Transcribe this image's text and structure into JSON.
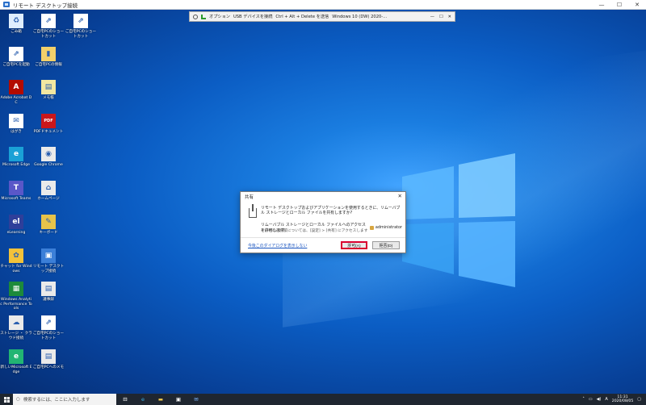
{
  "window": {
    "title": "リモート デスクトップ接続",
    "minimize": "—",
    "maximize": "☐",
    "close": "✕"
  },
  "rdp_bar": {
    "options": "オプション",
    "usb": "USB デバイスを接続",
    "cad": "Ctrl + Alt + Delete を送信",
    "host": "Windows 10 (DW) 2020-..."
  },
  "desktop_icons": [
    {
      "id": "recycle",
      "label": "ごみ箱",
      "glyph": "♻",
      "color": "#dfeeff"
    },
    {
      "id": "shortcut-a",
      "label": "ご自宅PCのショートカット",
      "glyph": "⇗",
      "color": "#ffffff"
    },
    {
      "id": "shortcut-b",
      "label": "ご自宅PCのショートカット",
      "glyph": "⇗",
      "color": "#ffffff"
    },
    {
      "id": "remote",
      "label": "ご自宅PCを起動",
      "glyph": "⇗",
      "color": "#ffffff"
    },
    {
      "id": "folder",
      "label": "ご自宅PCの情報",
      "glyph": "▮",
      "color": "#f2d06b"
    },
    {
      "id": "acrobat",
      "label": "Adobe Acrobat DC",
      "glyph": "A",
      "color": "#b30b00"
    },
    {
      "id": "memo",
      "label": "メモ帳",
      "glyph": "▤",
      "color": "#f2e7a1"
    },
    {
      "id": "mail",
      "label": "はがき",
      "glyph": "✉",
      "color": "#ffffff"
    },
    {
      "id": "pdf",
      "label": "PDFドキュメント",
      "glyph": "PDF",
      "color": "#c9161b"
    },
    {
      "id": "edge",
      "label": "Microsoft Edge",
      "glyph": "e",
      "color": "#1aa1d6"
    },
    {
      "id": "chrome",
      "label": "Google Chrome",
      "glyph": "◉",
      "color": "#eaeaea"
    },
    {
      "id": "teams",
      "label": "Microsoft Teams",
      "glyph": "T",
      "color": "#5a57c8"
    },
    {
      "id": "home",
      "label": "ホームページ",
      "glyph": "⌂",
      "color": "#eaeaea"
    },
    {
      "id": "el",
      "label": "eLearning",
      "glyph": "el",
      "color": "#2f3f9a"
    },
    {
      "id": "keys",
      "label": "キーボード",
      "glyph": "✎",
      "color": "#e6c34a"
    },
    {
      "id": "chat",
      "label": "チャット for Windows",
      "glyph": "✿",
      "color": "#f2c23a"
    },
    {
      "id": "pc",
      "label": "リモート デスクトップ接続",
      "glyph": "▣",
      "color": "#3b7fd8"
    },
    {
      "id": "perf",
      "label": "Windows Analytic Performance Tools",
      "glyph": "▦",
      "color": "#1d8a3b"
    },
    {
      "id": "note",
      "label": "議事録",
      "glyph": "▤",
      "color": "#eaeaea"
    },
    {
      "id": "cloud",
      "label": "ストレージ ・ クラウド接続",
      "glyph": "☁",
      "color": "#eaeaea"
    },
    {
      "id": "shortcut-c",
      "label": "ご自宅PCのショートカット",
      "glyph": "⇗",
      "color": "#ffffff"
    },
    {
      "id": "edge2",
      "label": "新しいMicrosoft Edge",
      "glyph": "e",
      "color": "#22b573"
    },
    {
      "id": "doc",
      "label": "ご自宅PCへのメモ",
      "glyph": "▤",
      "color": "#eaeaea"
    }
  ],
  "dialog": {
    "title": "共有",
    "close": "✕",
    "main_text": "リモート デスクトップおよびアプリケーションを使用するときに、リムーバブル ストレージとローカル ファイルを共有しますか?",
    "sub_text": "リムーバブル ストレージとローカル ファイルへのアクセスを許可します:",
    "user": "administrator",
    "note": "その他の選択肢については、[設定] > [共有] にアクセスします",
    "dont_show": "今後このダイアログを表示しない",
    "allow": "許可(A)",
    "deny": "拒否(D)",
    "allow_highlight": "#d9002f"
  },
  "taskbar": {
    "search_placeholder": "検索するには、ここに入力します",
    "time": "11:31",
    "date": "2020/08/05"
  }
}
